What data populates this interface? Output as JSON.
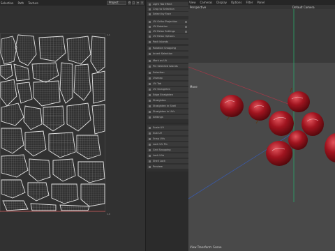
{
  "uv_editor": {
    "menu": [
      "Selection",
      "Path",
      "Texture"
    ],
    "mode": "Project",
    "corner_top": "1,1",
    "corner_bottom": "1,0"
  },
  "settings_list": {
    "rows": [
      "Light Tab Effect",
      "Crop to Selection",
      "Select by Face",
      "UV Ortho Projection",
      "UV Rotation",
      "UV Relax Settings",
      "UV Relax Options",
      "Pack Islands",
      "Rotation Snapping",
      "Invert Selection",
      "Mark as UV",
      "Pin Selected Islands",
      "Selection",
      "Unwrap",
      "UV Tab",
      "UV Straighten",
      "Edge Straighten",
      "Straighten",
      "Straighten in Shell",
      "Straighten in UVs",
      "Settings",
      "Scale UV",
      "Sub UV",
      "Snap UVs",
      "Lock UV Pin",
      "Grid Snapping",
      "Lock UVs",
      "Shell Lock",
      "Preview"
    ]
  },
  "viewport": {
    "menu": [
      "View",
      "Cameras",
      "Display",
      "Options",
      "Filter",
      "Panel"
    ],
    "view_name": "Perspective",
    "camera_name": "Default Camera",
    "move_label": "Move",
    "footer": "View Transform: Scene",
    "apple_color": "#9b1220",
    "grid_axis_color": "#2aa86a"
  }
}
